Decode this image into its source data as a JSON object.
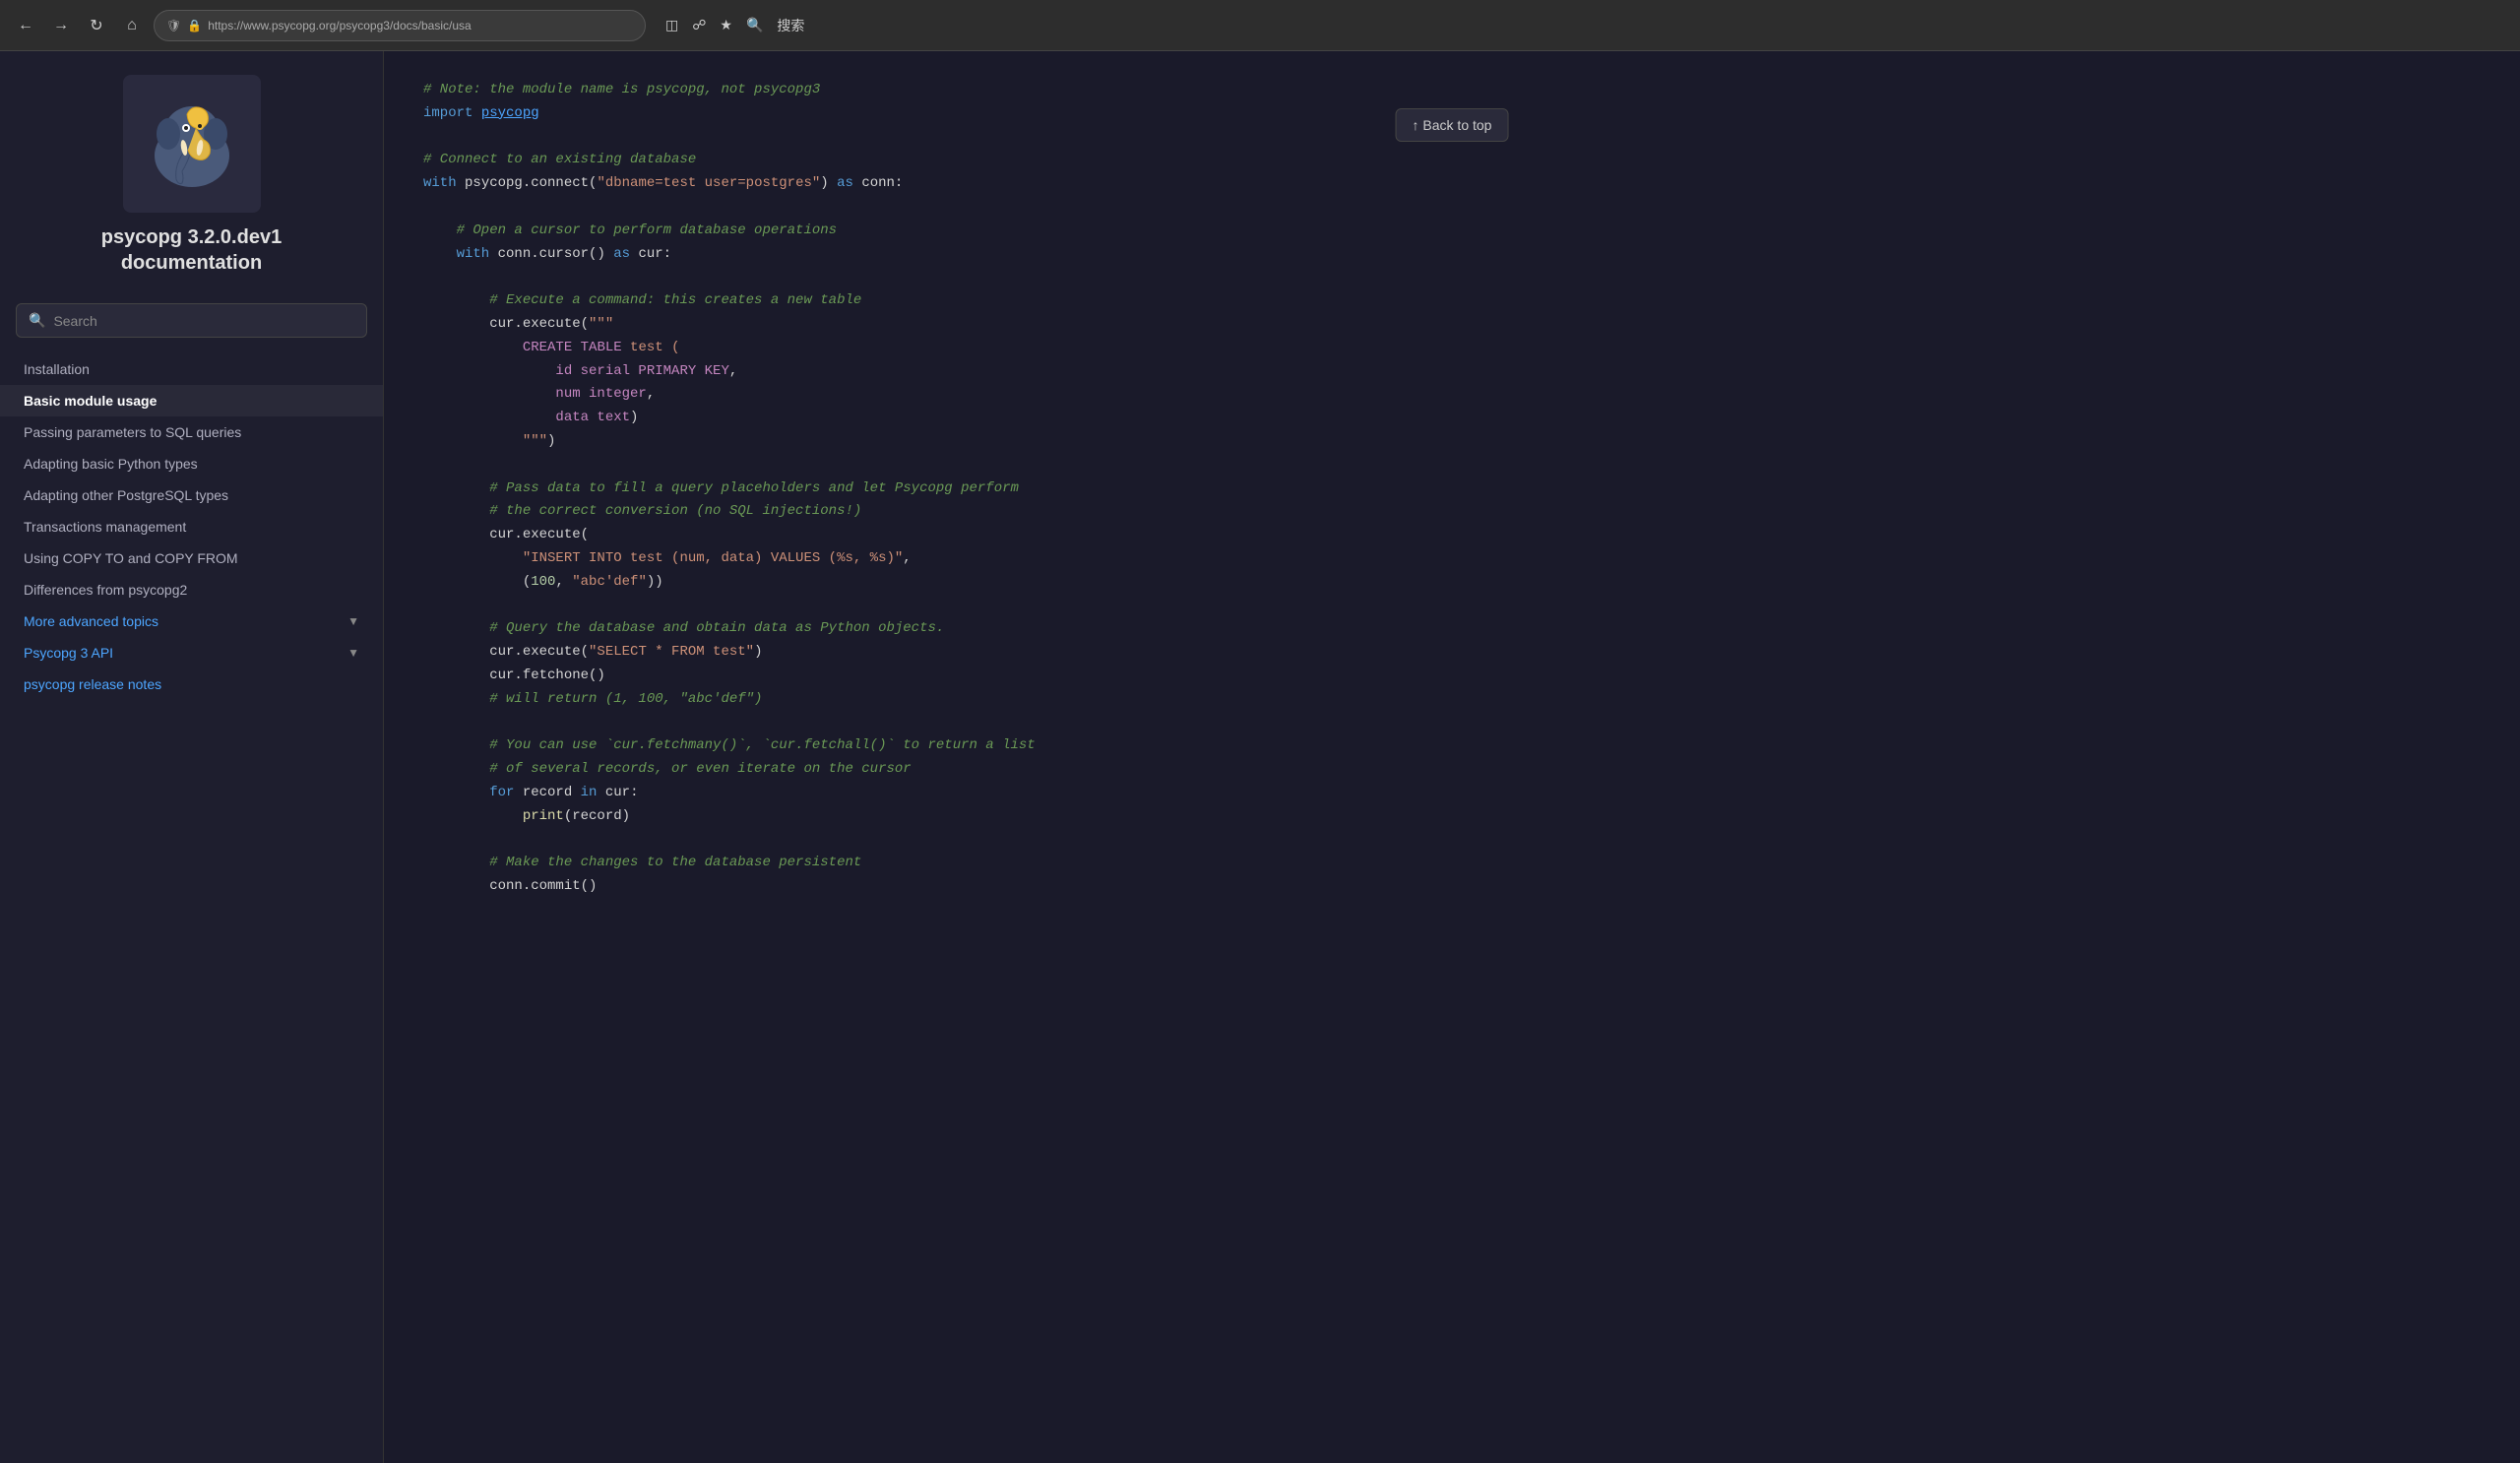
{
  "browser": {
    "url": "https://www.psycopg.org/psycopg3/docs/basic/usa",
    "search_label": "搜索"
  },
  "sidebar": {
    "title": "psycopg 3.2.0.dev1\ndocumentation",
    "search_placeholder": "Search",
    "nav_items": [
      {
        "id": "installation",
        "label": "Installation",
        "active": false,
        "expandable": false,
        "blue": false
      },
      {
        "id": "basic-module-usage",
        "label": "Basic module usage",
        "active": true,
        "expandable": false,
        "blue": false
      },
      {
        "id": "passing-parameters",
        "label": "Passing parameters to SQL queries",
        "active": false,
        "expandable": false,
        "blue": false
      },
      {
        "id": "adapting-basic",
        "label": "Adapting basic Python types",
        "active": false,
        "expandable": false,
        "blue": false
      },
      {
        "id": "adapting-other",
        "label": "Adapting other PostgreSQL types",
        "active": false,
        "expandable": false,
        "blue": false
      },
      {
        "id": "transactions",
        "label": "Transactions management",
        "active": false,
        "expandable": false,
        "blue": false
      },
      {
        "id": "copy",
        "label": "Using COPY TO and COPY FROM",
        "active": false,
        "expandable": false,
        "blue": false
      },
      {
        "id": "diff-psycopg2",
        "label": "Differences from psycopg2",
        "active": false,
        "expandable": false,
        "blue": false
      },
      {
        "id": "advanced-topics",
        "label": "More advanced topics",
        "active": false,
        "expandable": true,
        "blue": true
      },
      {
        "id": "psycopg3-api",
        "label": "Psycopg 3 API",
        "active": false,
        "expandable": true,
        "blue": true
      },
      {
        "id": "release-notes",
        "label": "psycopg release notes",
        "active": false,
        "expandable": false,
        "blue": true
      }
    ]
  },
  "back_to_top": "↑ Back to top",
  "code": {
    "lines": [
      {
        "text": "# Note: the module name is psycopg, not psycopg3",
        "type": "comment"
      },
      {
        "text": "import psycopg",
        "type": "import"
      },
      {
        "text": "",
        "type": "blank"
      },
      {
        "text": "# Connect to an existing database",
        "type": "comment"
      },
      {
        "text": "with psycopg.connect(\"dbname=test user=postgres\") as conn:",
        "type": "code"
      },
      {
        "text": "",
        "type": "blank"
      },
      {
        "text": "    # Open a cursor to perform database operations",
        "type": "comment_indent"
      },
      {
        "text": "    with conn.cursor() as cur:",
        "type": "code_indent"
      },
      {
        "text": "",
        "type": "blank"
      },
      {
        "text": "        # Execute a command: this creates a new table",
        "type": "comment_indent2"
      },
      {
        "text": "        cur.execute(\"\"\"",
        "type": "code_indent2"
      },
      {
        "text": "            CREATE TABLE test (",
        "type": "sql"
      },
      {
        "text": "                id serial PRIMARY KEY,",
        "type": "sql"
      },
      {
        "text": "                num integer,",
        "type": "sql"
      },
      {
        "text": "                data text)",
        "type": "sql"
      },
      {
        "text": "            \"\"\")",
        "type": "code_indent2_end"
      },
      {
        "text": "",
        "type": "blank"
      },
      {
        "text": "        # Pass data to fill a query placeholders and let Psycopg perform",
        "type": "comment_indent2"
      },
      {
        "text": "        # the correct conversion (no SQL injections!)",
        "type": "comment_indent2"
      },
      {
        "text": "        cur.execute(",
        "type": "code_indent2"
      },
      {
        "text": "            \"INSERT INTO test (num, data) VALUES (%s, %s)\",",
        "type": "string_indent"
      },
      {
        "text": "            (100, \"abc'def\"))",
        "type": "args_indent"
      },
      {
        "text": "",
        "type": "blank"
      },
      {
        "text": "        # Query the database and obtain data as Python objects.",
        "type": "comment_indent2"
      },
      {
        "text": "        cur.execute(\"SELECT * FROM test\")",
        "type": "code_indent2"
      },
      {
        "text": "        cur.fetchone()",
        "type": "code_indent2"
      },
      {
        "text": "        # will return (1, 100, \"abc'def\")",
        "type": "comment_indent2"
      },
      {
        "text": "",
        "type": "blank"
      },
      {
        "text": "        # You can use `cur.fetchmany()`, `cur.fetchall()` to return a list",
        "type": "comment_indent2"
      },
      {
        "text": "        # of several records, or even iterate on the cursor",
        "type": "comment_indent2"
      },
      {
        "text": "        for record in cur:",
        "type": "code_indent2"
      },
      {
        "text": "            print(record)",
        "type": "code_indent3"
      },
      {
        "text": "",
        "type": "blank"
      },
      {
        "text": "        # Make the changes to the database persistent",
        "type": "comment_indent2"
      },
      {
        "text": "        conn.commit()",
        "type": "code_indent2"
      }
    ]
  }
}
